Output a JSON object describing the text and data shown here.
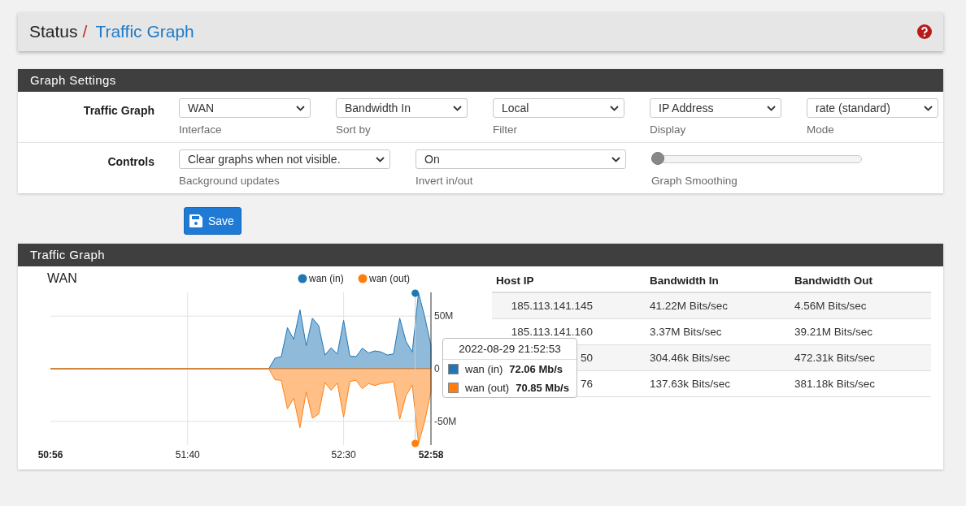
{
  "breadcrumb": {
    "section": "Status",
    "separator": "/",
    "page": "Traffic Graph"
  },
  "settings": {
    "title": "Graph Settings",
    "rows": [
      {
        "label": "Traffic Graph",
        "controls": [
          {
            "kind": "select",
            "value": "WAN",
            "help": "Interface"
          },
          {
            "kind": "select",
            "value": "Bandwidth In",
            "help": "Sort by"
          },
          {
            "kind": "select",
            "value": "Local",
            "help": "Filter"
          },
          {
            "kind": "select",
            "value": "IP Address",
            "help": "Display"
          },
          {
            "kind": "select",
            "value": "rate (standard)",
            "help": "Mode"
          }
        ]
      },
      {
        "label": "Controls",
        "controls": [
          {
            "kind": "select",
            "value": "Clear graphs when not visible.",
            "help": "Background updates"
          },
          {
            "kind": "select",
            "value": "On",
            "help": "Invert in/out"
          },
          {
            "kind": "slider",
            "level": 0,
            "help": "Graph Smoothing"
          }
        ]
      }
    ]
  },
  "save_button": "Save",
  "graph_panel": {
    "title": "Traffic Graph",
    "chart_data": {
      "type": "area",
      "title": "WAN",
      "categories": [
        "50:56",
        null,
        null,
        null,
        null,
        null,
        null,
        null,
        null,
        null,
        null,
        null,
        null,
        null,
        null,
        null,
        null,
        null,
        null,
        null,
        null,
        null,
        "51:40",
        null,
        null,
        null,
        null,
        null,
        null,
        null,
        null,
        null,
        null,
        null,
        null,
        null,
        null,
        null,
        null,
        null,
        null,
        null,
        null,
        null,
        null,
        null,
        null,
        "52:30",
        null,
        null,
        null,
        null,
        null,
        null,
        null,
        null,
        null,
        null,
        null,
        null,
        null,
        "52:58"
      ],
      "series": [
        {
          "name": "wan (in)",
          "color": "#1f77b4",
          "values": [
            0,
            0,
            0,
            0,
            0,
            0,
            0,
            0,
            0,
            0,
            0,
            0,
            0,
            0,
            0,
            0,
            0,
            0,
            0,
            0,
            0,
            0,
            0,
            0,
            0,
            0,
            0,
            0,
            0,
            0,
            0,
            0,
            0,
            0,
            0,
            0,
            10,
            11.5,
            39,
            28,
            56,
            22,
            48,
            41,
            13,
            20,
            14,
            46,
            12,
            11.5,
            19.5,
            15,
            17,
            16,
            13,
            14,
            48,
            26,
            16,
            72,
            49.5,
            22
          ]
        },
        {
          "name": "wan (out)",
          "color": "#ff7f0e",
          "values": [
            0,
            0,
            0,
            0,
            0,
            0,
            0,
            0,
            0,
            0,
            0,
            0,
            0,
            0,
            0,
            0,
            0,
            0,
            0,
            0,
            0,
            0,
            0,
            0,
            0,
            0,
            0,
            0,
            0,
            0,
            0,
            0,
            0,
            0,
            0,
            0,
            -10.5,
            -11,
            -38,
            -28,
            -56,
            -22,
            -47,
            -43,
            -13,
            -20.5,
            -13.5,
            -46,
            -12,
            -11,
            -19,
            -14,
            -16,
            -14,
            -13.5,
            -12,
            -48,
            -25.5,
            -15.5,
            -71,
            -50,
            -22
          ]
        }
      ],
      "grid": true,
      "ylim": [
        -72.5,
        72.5
      ],
      "yticks": [
        {
          "value": -50,
          "label": "-50M"
        },
        {
          "value": 0,
          "label": "0"
        },
        {
          "value": 50,
          "label": "50M"
        }
      ]
    },
    "tooltip": {
      "title": "2022-08-29 21:52:53",
      "rows": [
        {
          "label": "wan (in)",
          "value": "72.06 Mb/s",
          "color": "#1f77b4"
        },
        {
          "label": "wan (out)",
          "value": "70.85 Mb/s",
          "color": "#ff7f0e"
        }
      ]
    },
    "table": {
      "columns": [
        "Host IP",
        "Bandwidth In",
        "Bandwidth Out"
      ],
      "rows": [
        [
          "185.113.141.145",
          "41.22M Bits/sec",
          "4.56M Bits/sec"
        ],
        [
          "185.113.141.160",
          "3.37M Bits/sec",
          "39.21M Bits/sec"
        ],
        [
          "50",
          "304.46k Bits/sec",
          "472.31k Bits/sec"
        ],
        [
          "76",
          "137.63k Bits/sec",
          "381.18k Bits/sec"
        ]
      ]
    }
  }
}
